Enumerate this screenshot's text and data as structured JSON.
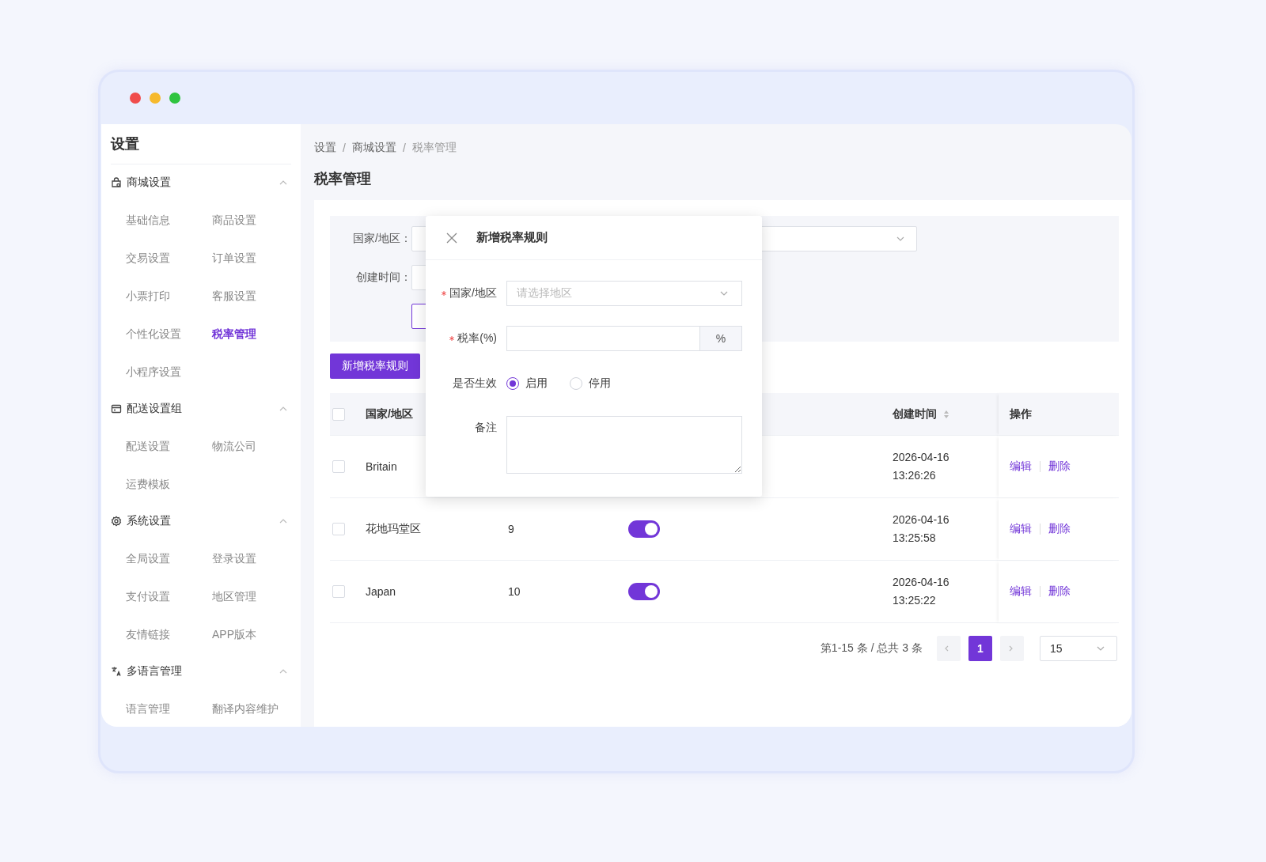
{
  "window": {
    "controls": [
      {
        "color": "#f04c4c"
      },
      {
        "color": "#f6b92d"
      },
      {
        "color": "#2fc43f"
      }
    ]
  },
  "sidebar": {
    "title": "设置",
    "groups": [
      {
        "kind": "shop",
        "label": "商城设置",
        "expanded": true,
        "items": [
          {
            "label": "基础信息",
            "selected": false
          },
          {
            "label": "商品设置",
            "selected": false
          },
          {
            "label": "交易设置",
            "selected": false
          },
          {
            "label": "订单设置",
            "selected": false
          },
          {
            "label": "小票打印",
            "selected": false
          },
          {
            "label": "客服设置",
            "selected": false
          },
          {
            "label": "个性化设置",
            "selected": false
          },
          {
            "label": "税率管理",
            "selected": true
          },
          {
            "label": "小程序设置",
            "selected": false
          }
        ]
      },
      {
        "kind": "delivery",
        "label": "配送设置组",
        "expanded": true,
        "items": [
          {
            "label": "配送设置",
            "selected": false
          },
          {
            "label": "物流公司",
            "selected": false
          },
          {
            "label": "运费模板",
            "selected": false
          }
        ]
      },
      {
        "kind": "system",
        "label": "系统设置",
        "expanded": true,
        "items": [
          {
            "label": "全局设置",
            "selected": false
          },
          {
            "label": "登录设置",
            "selected": false
          },
          {
            "label": "支付设置",
            "selected": false
          },
          {
            "label": "地区管理",
            "selected": false
          },
          {
            "label": "友情链接",
            "selected": false
          },
          {
            "label": "APP版本",
            "selected": false
          }
        ]
      },
      {
        "kind": "language",
        "label": "多语言管理",
        "expanded": true,
        "items": [
          {
            "label": "语言管理",
            "selected": false
          },
          {
            "label": "翻译内容维护",
            "selected": false
          }
        ]
      }
    ]
  },
  "breadcrumb": [
    {
      "kind": "link",
      "label": "设置"
    },
    {
      "kind": "separator",
      "label": "/"
    },
    {
      "kind": "link",
      "label": "商城设置"
    },
    {
      "kind": "separator",
      "label": "/"
    },
    {
      "kind": "current",
      "label": "税率管理"
    }
  ],
  "page_title": "税率管理",
  "filters": [
    {
      "label": "国家/地区："
    },
    {
      "label": "创建时间："
    }
  ],
  "add_button": "新增税率规则",
  "table": {
    "header_checked": false,
    "columns": [
      {
        "kind": "name",
        "label": "国家/地区"
      },
      {
        "kind": "created",
        "label": "创建时间",
        "sortable": true
      },
      {
        "kind": "actions",
        "label": "操作"
      }
    ],
    "rows": [
      {
        "checked": false,
        "name": "Britain",
        "created": "2026-04-16 13:26:26",
        "actions": [
          "编辑",
          "删除"
        ]
      },
      {
        "checked": false,
        "name": "花地玛堂区",
        "rate": "9",
        "enabled": true,
        "created": "2026-04-16 13:25:58",
        "actions": [
          "编辑",
          "删除"
        ]
      },
      {
        "checked": false,
        "name": "Japan",
        "rate": "10",
        "enabled": true,
        "created": "2026-04-16 13:25:22",
        "actions": [
          "编辑",
          "删除"
        ]
      }
    ]
  },
  "pagination": {
    "summary": "第1-15 条 / 总共 3 条",
    "pages": [
      {
        "label": "1",
        "selected": true
      }
    ],
    "page_size": "15"
  },
  "dialog": {
    "title": "新增税率规则",
    "fields": [
      {
        "kind": "select",
        "label": "国家/地区",
        "required": true,
        "placeholder": "请选择地区"
      },
      {
        "kind": "input",
        "label": "税率(%)",
        "required": true,
        "suffix": "%"
      },
      {
        "kind": "radio",
        "label": "是否生效",
        "required": false,
        "options": [
          {
            "label": "启用",
            "selected": true
          },
          {
            "label": "停用",
            "selected": false
          }
        ]
      },
      {
        "kind": "textarea",
        "label": "备注",
        "required": false
      }
    ]
  }
}
